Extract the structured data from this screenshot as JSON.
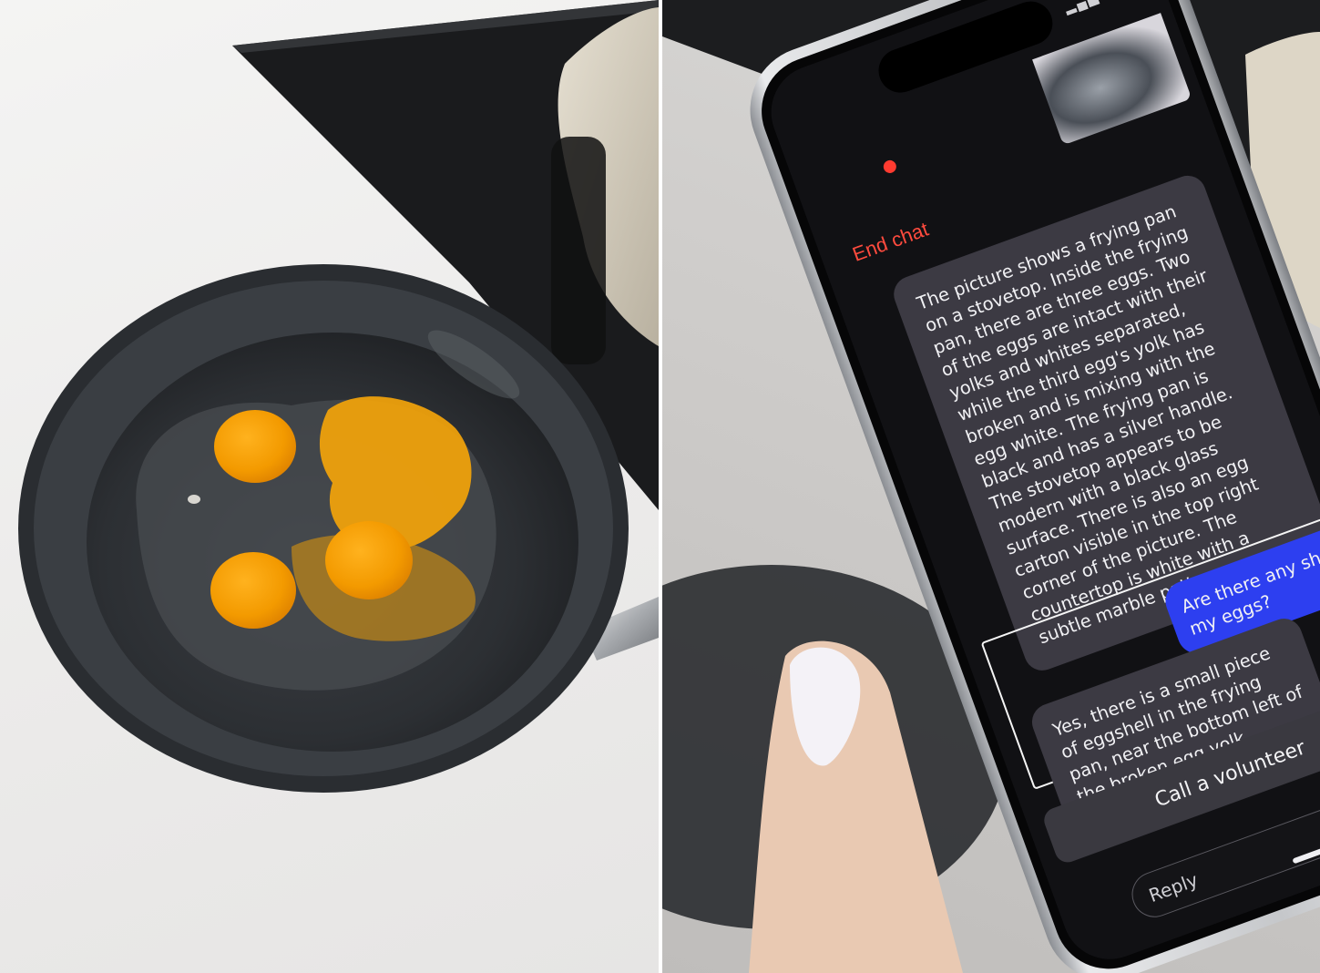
{
  "chat": {
    "end_chat_label": "End chat",
    "messages": [
      {
        "role": "assistant",
        "text": "The picture shows a frying pan on a stovetop. Inside the frying pan, there are three eggs. Two of the eggs are intact with their yolks and whites separated, while the third egg's yolk has broken and is mixing with the egg white. The frying pan is black and has a silver handle. The stovetop appears to be modern with a black glass surface. There is also an egg carton visible in the top right corner of the picture. The countertop is white with a subtle marble pattern."
      },
      {
        "role": "user",
        "text": "Are there any shells in my eggs?"
      },
      {
        "role": "assistant",
        "text": "Yes, there is a small piece of eggshell in the frying pan, near the bottom left of the broken egg yolk."
      }
    ],
    "call_volunteer_label": "Call a volunteer",
    "reply_placeholder": "Reply",
    "close_symbol": "✕"
  },
  "colors": {
    "end_chat": "#ff4b3e",
    "user_bubble": "#2d3ff0",
    "assistant_bubble": "#3c3a43",
    "screen_background": "#111114",
    "recording_dot": "#ff3b30"
  },
  "icons": {
    "status": [
      "signal-icon",
      "wifi-icon",
      "battery-icon"
    ],
    "close": "close-icon"
  }
}
